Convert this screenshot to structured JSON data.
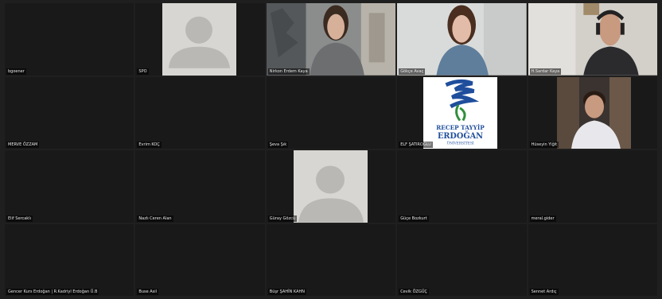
{
  "participants": [
    {
      "name": "bgoener"
    },
    {
      "name": "SPO"
    },
    {
      "name": "Nirkon Erdem Kaya"
    },
    {
      "name": "Gökçe Avaç"
    },
    {
      "name": "H.Sardar Kaya"
    },
    {
      "name": "MERVE ÖZZAM"
    },
    {
      "name": "Evrim KOÇ"
    },
    {
      "name": "Şeva Şık"
    },
    {
      "name": "ELF ŞATIROĞLU"
    },
    {
      "name": "Hüseyin Yiğit"
    },
    {
      "name": "Elif Sercaklı"
    },
    {
      "name": "Nazlı Ceren Alan"
    },
    {
      "name": "Güray Gözcü"
    },
    {
      "name": "Güçe Bozkurt"
    },
    {
      "name": "meral.gider"
    },
    {
      "name": "Gencer Kurs Erdoğan | R.Kadriyl Erdoğan Ü.B"
    },
    {
      "name": "Buse Asil"
    },
    {
      "name": "Büşr ŞAHİN KAHN"
    },
    {
      "name": "Cevik ÖZGÜÇ"
    },
    {
      "name": "Sennet Ardıç"
    }
  ],
  "logo": {
    "line1": "RECEP TAYYİP",
    "line2": "ERDOĞAN",
    "line3": "ÜNİVERSİTESİ",
    "colors": {
      "blue": "#1f4e9c",
      "green": "#2f8f3a"
    }
  },
  "theme": {
    "background": "#1f1f1f",
    "tile": "#191919",
    "label": "#e8e8e8"
  }
}
